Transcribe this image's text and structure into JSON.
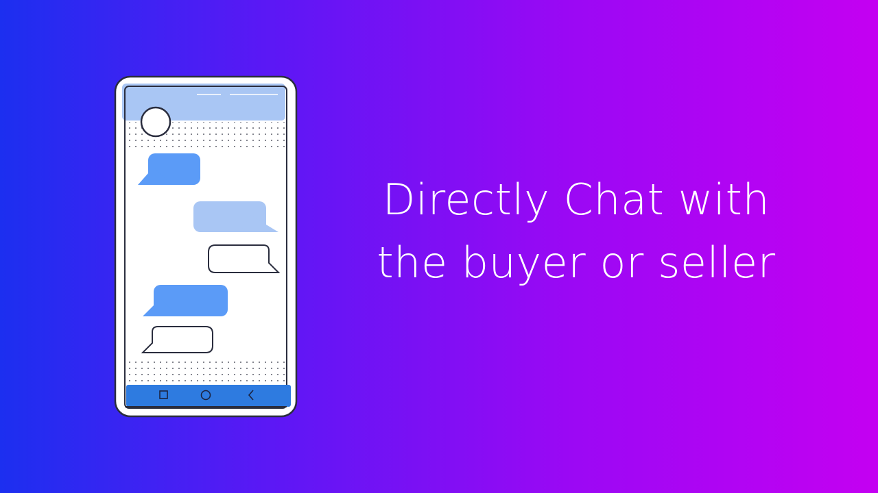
{
  "headline": {
    "line1": "Directly Chat with",
    "line2": "the buyer or seller"
  },
  "colors": {
    "gradient_start": "#1c2ff0",
    "gradient_end": "#c400f2",
    "bubble_primary": "#5b9bf7",
    "bubble_light": "#a9c6f4",
    "header_bar": "#a9c6f4",
    "nav_bar": "#2e7be0",
    "outline": "#2a2d3e",
    "text": "#ffffff"
  },
  "icons": {
    "nav_left": "square-icon",
    "nav_center": "circle-icon",
    "nav_right": "back-chevron-icon"
  }
}
